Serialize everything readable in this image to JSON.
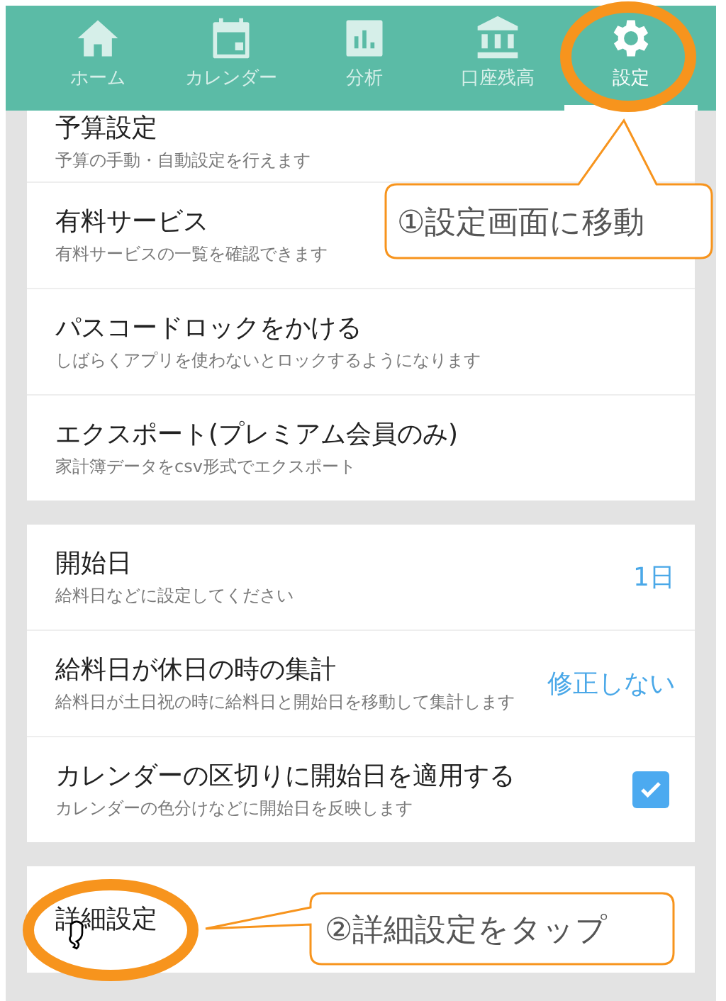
{
  "tabs": [
    {
      "label": "ホーム",
      "selected": false
    },
    {
      "label": "カレンダー",
      "selected": false
    },
    {
      "label": "分析",
      "selected": false
    },
    {
      "label": "口座残高",
      "selected": false
    },
    {
      "label": "設定",
      "selected": true
    }
  ],
  "sections": [
    {
      "rows": [
        {
          "kind": "plain",
          "title": "予算設定",
          "subtitle": "予算の手動・自動設定を行えます"
        },
        {
          "kind": "plain",
          "title": "有料サービス",
          "subtitle": "有料サービスの一覧を確認できます"
        },
        {
          "kind": "plain",
          "title": "パスコードロックをかける",
          "subtitle": "しばらくアプリを使わないとロックするようになります"
        },
        {
          "kind": "plain",
          "title": "エクスポート(プレミアム会員のみ)",
          "subtitle": "家計簿データをcsv形式でエクスポート"
        }
      ]
    },
    {
      "rows": [
        {
          "kind": "value",
          "title": "開始日",
          "subtitle": "給料日などに設定してください",
          "value": "1日"
        },
        {
          "kind": "value",
          "title": "給料日が休日の時の集計",
          "subtitle": "給料日が土日祝の時に給料日と開始日を移動して集計します",
          "value": "修正しない"
        },
        {
          "kind": "checkbox",
          "title": "カレンダーの区切りに開始日を適用する",
          "subtitle": "カレンダーの色分けなどに開始日を反映します",
          "checked": true
        }
      ]
    },
    {
      "rows": [
        {
          "kind": "plain",
          "title": "詳細設定"
        }
      ]
    }
  ],
  "annotations": [
    {
      "text": "①設定画面に移動"
    },
    {
      "text": "②詳細設定をタップ"
    }
  ]
}
